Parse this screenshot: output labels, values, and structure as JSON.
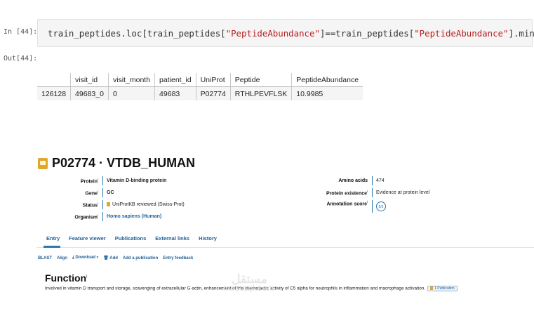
{
  "notebook": {
    "in_prompt": "In [44]:",
    "out_prompt": "Out[44]:",
    "code": {
      "p1": "train_peptides.loc[train_peptides[",
      "s1": "\"PeptideAbundance\"",
      "p2": "]==train_peptides[",
      "s2": "\"PeptideAbundance\"",
      "p3": "].min()]"
    },
    "table": {
      "columns": [
        "",
        "visit_id",
        "visit_month",
        "patient_id",
        "UniProt",
        "Peptide",
        "PeptideAbundance"
      ],
      "rows": [
        [
          "126128",
          "49683_0",
          "0",
          "49683",
          "P02774",
          "RTHLPEVFLSK",
          "10.9985"
        ]
      ]
    }
  },
  "uniprot": {
    "title": "P02774 · VTDB_HUMAN",
    "fields_left": [
      {
        "label": "Protein",
        "value": "Vitamin D-binding protein"
      },
      {
        "label": "Gene",
        "value": "GC"
      },
      {
        "label": "Status",
        "value": "UniProtKB reviewed (Swiss-Prot)"
      },
      {
        "label": "Organism",
        "value": "Homo sapiens (Human)"
      }
    ],
    "fields_right": [
      {
        "label": "Amino acids",
        "value": "474"
      },
      {
        "label": "Protein existence",
        "value": "Evidence at protein level"
      },
      {
        "label": "Annotation score",
        "value": "5/5"
      }
    ],
    "info_mark": "i",
    "tabs": [
      "Entry",
      "Feature viewer",
      "Publications",
      "External links",
      "History"
    ],
    "toolbar": [
      "BLAST",
      "Align",
      "Download",
      "Add",
      "Add a publication",
      "Entry feedback"
    ],
    "function_title": "Function",
    "function_text": "Involved in vitamin D transport and storage, scavenging of extracellular G-actin, enhancement of the chemotactic activity of C5 alpha for neutrophils in inflammation and macrophage activation.",
    "publication_tag": "1 Publication",
    "watermark": "mostaql.com",
    "watermark_ar": "مستقل",
    "colors": {
      "link": "#1f5f99",
      "badge": "#e2a72a",
      "accent": "#2a7ab0"
    }
  }
}
